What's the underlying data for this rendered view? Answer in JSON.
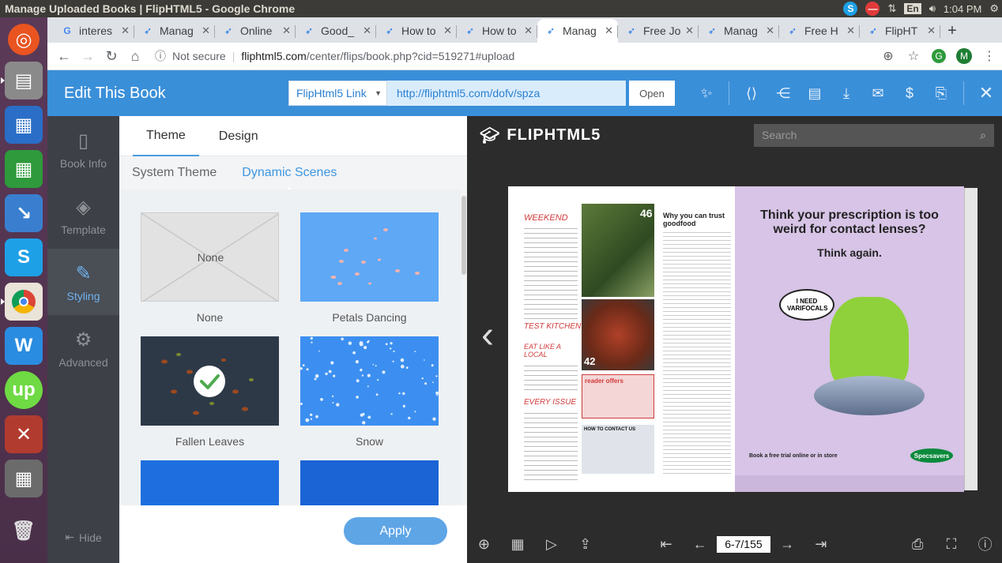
{
  "window": {
    "title": "Manage Uploaded Books | FlipHTML5 - Google Chrome"
  },
  "tray": {
    "lang": "En",
    "time": "1:04 PM"
  },
  "tabs": [
    {
      "label": "interes",
      "favicon": "G"
    },
    {
      "label": "Manag",
      "favicon": "bird"
    },
    {
      "label": "Online",
      "favicon": "bird"
    },
    {
      "label": "Good_",
      "favicon": "bird"
    },
    {
      "label": "How to",
      "favicon": "bird"
    },
    {
      "label": "How to",
      "favicon": "bird"
    },
    {
      "label": "Manag",
      "favicon": "bird"
    },
    {
      "label": "Free Jo",
      "favicon": "bird"
    },
    {
      "label": "Manag",
      "favicon": "bird"
    },
    {
      "label": "Free H",
      "favicon": "bird"
    },
    {
      "label": "FlipHT",
      "favicon": "bird"
    }
  ],
  "address": {
    "security": "Not secure",
    "domain": "fliphtml5.com",
    "path": "/center/flips/book.php?cid=519271#upload",
    "profile_initial": "M"
  },
  "header": {
    "title": "Edit This Book",
    "link_type": "FlipHtml5 Link",
    "link_url": "http://fliphtml5.com/dofv/spza",
    "open_label": "Open"
  },
  "sidebar": {
    "items": [
      {
        "label": "Book Info",
        "icon": "book-icon"
      },
      {
        "label": "Template",
        "icon": "template-icon"
      },
      {
        "label": "Styling",
        "icon": "palette-icon"
      },
      {
        "label": "Advanced",
        "icon": "gear-icon"
      }
    ],
    "hide_label": "Hide"
  },
  "panel": {
    "tabs": [
      "Theme",
      "Design"
    ],
    "subtabs": [
      "System Theme",
      "Dynamic Scenes"
    ],
    "scenes": [
      {
        "label": "None",
        "thumb_text": "None"
      },
      {
        "label": "Petals Dancing"
      },
      {
        "label": "Fallen Leaves",
        "selected": true
      },
      {
        "label": "Snow"
      },
      {
        "label": ""
      },
      {
        "label": ""
      }
    ],
    "apply_label": "Apply"
  },
  "preview": {
    "brand": "FLIPHTML5",
    "search_placeholder": "Search",
    "page_indicator": "6-7/155",
    "left_page": {
      "sections": [
        "WEEKEND",
        "TEST KITCHEN",
        "EAT LIKE A LOCAL",
        "EVERY ISSUE"
      ],
      "heading": "Why you can trust goodfood",
      "offers": "reader offers",
      "contact": "HOW TO CONTACT US",
      "numbers": [
        "46",
        "42"
      ]
    },
    "right_page": {
      "headline": "Think your prescription is too weird for contact lenses?",
      "subhead": "Think again.",
      "bubble": "I NEED VARIFOCALS",
      "footer": "Book a free trial online or in store",
      "logo": "Specsavers"
    }
  }
}
